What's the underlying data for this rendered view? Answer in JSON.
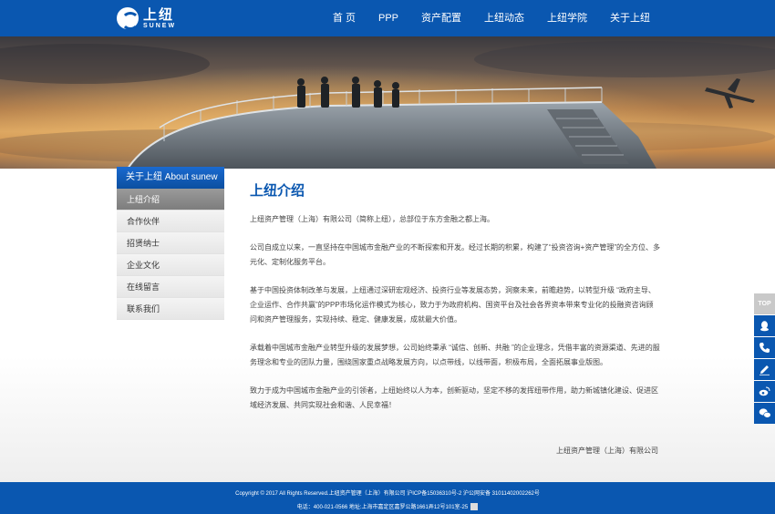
{
  "brand": {
    "name_cn": "上纽",
    "name_en": "SUNEW"
  },
  "nav": [
    "首 页",
    "PPP",
    "资产配置",
    "上纽动态",
    "上纽学院",
    "关于上纽"
  ],
  "sidebar": {
    "heading": "关于上纽 About sunew",
    "items": [
      "上纽介绍",
      "合作伙伴",
      "招贤纳士",
      "企业文化",
      "在线留言",
      "联系我们"
    ],
    "active_index": 0
  },
  "main": {
    "title": "上纽介绍",
    "paragraphs": [
      "上纽资产管理（上海）有限公司（简称上纽），总部位于东方金融之都上海。",
      "公司自成立以来，一直坚持在中国城市金融产业的不断探索和开发。经过长期的积累，构建了“投资咨询+资产管理”的全方位、多元化、定制化服务平台。",
      "基于中国投资体制改革与发展，上纽通过深研宏观经济、投资行业等发展态势，洞察未来，前瞻趋势，以转型升级 “政府主导、企业运作、合作共赢”的PPP市场化运作模式为核心，致力于为政府机构、国资平台及社会各界资本带来专业化的投融资咨询顾问和资产管理服务，实现持续、稳定、健康发展，成就最大价值。",
      "承载着中国城市金融产业转型升级的发展梦想，公司始终秉承 “诚信、创新、共融 ”的企业理念，凭借丰富的资源渠道、先进的服务理念和专业的团队力量，围绕国家重点战略发展方向，以点带线，以线带面，积极布局，全面拓展事业版图。",
      "致力于成为中国城市金融产业的引领者，上纽始终以人为本，创新驱动，坚定不移的发挥纽带作用，助力新城镇化建设、促进区域经济发展、共同实现社会和谐、人民幸福！"
    ],
    "signature": "上纽资产管理（上海）有限公司"
  },
  "toolbar": {
    "top_label": "TOP"
  },
  "footer": {
    "line1": "Copyright © 2017 All Rights Reserved.上纽资产管理（上海）有限公司 沪ICP备15036310号-2 沪公网安备 31011402002262号",
    "line2": "电话：400-021-0566 地址:上海市嘉定区嘉罗公路1661弄12号101室-25"
  },
  "colors": {
    "primary": "#0a57b0",
    "sidebar_active": "#8a8a8a",
    "toolbar_top": "#c9c9c9"
  }
}
